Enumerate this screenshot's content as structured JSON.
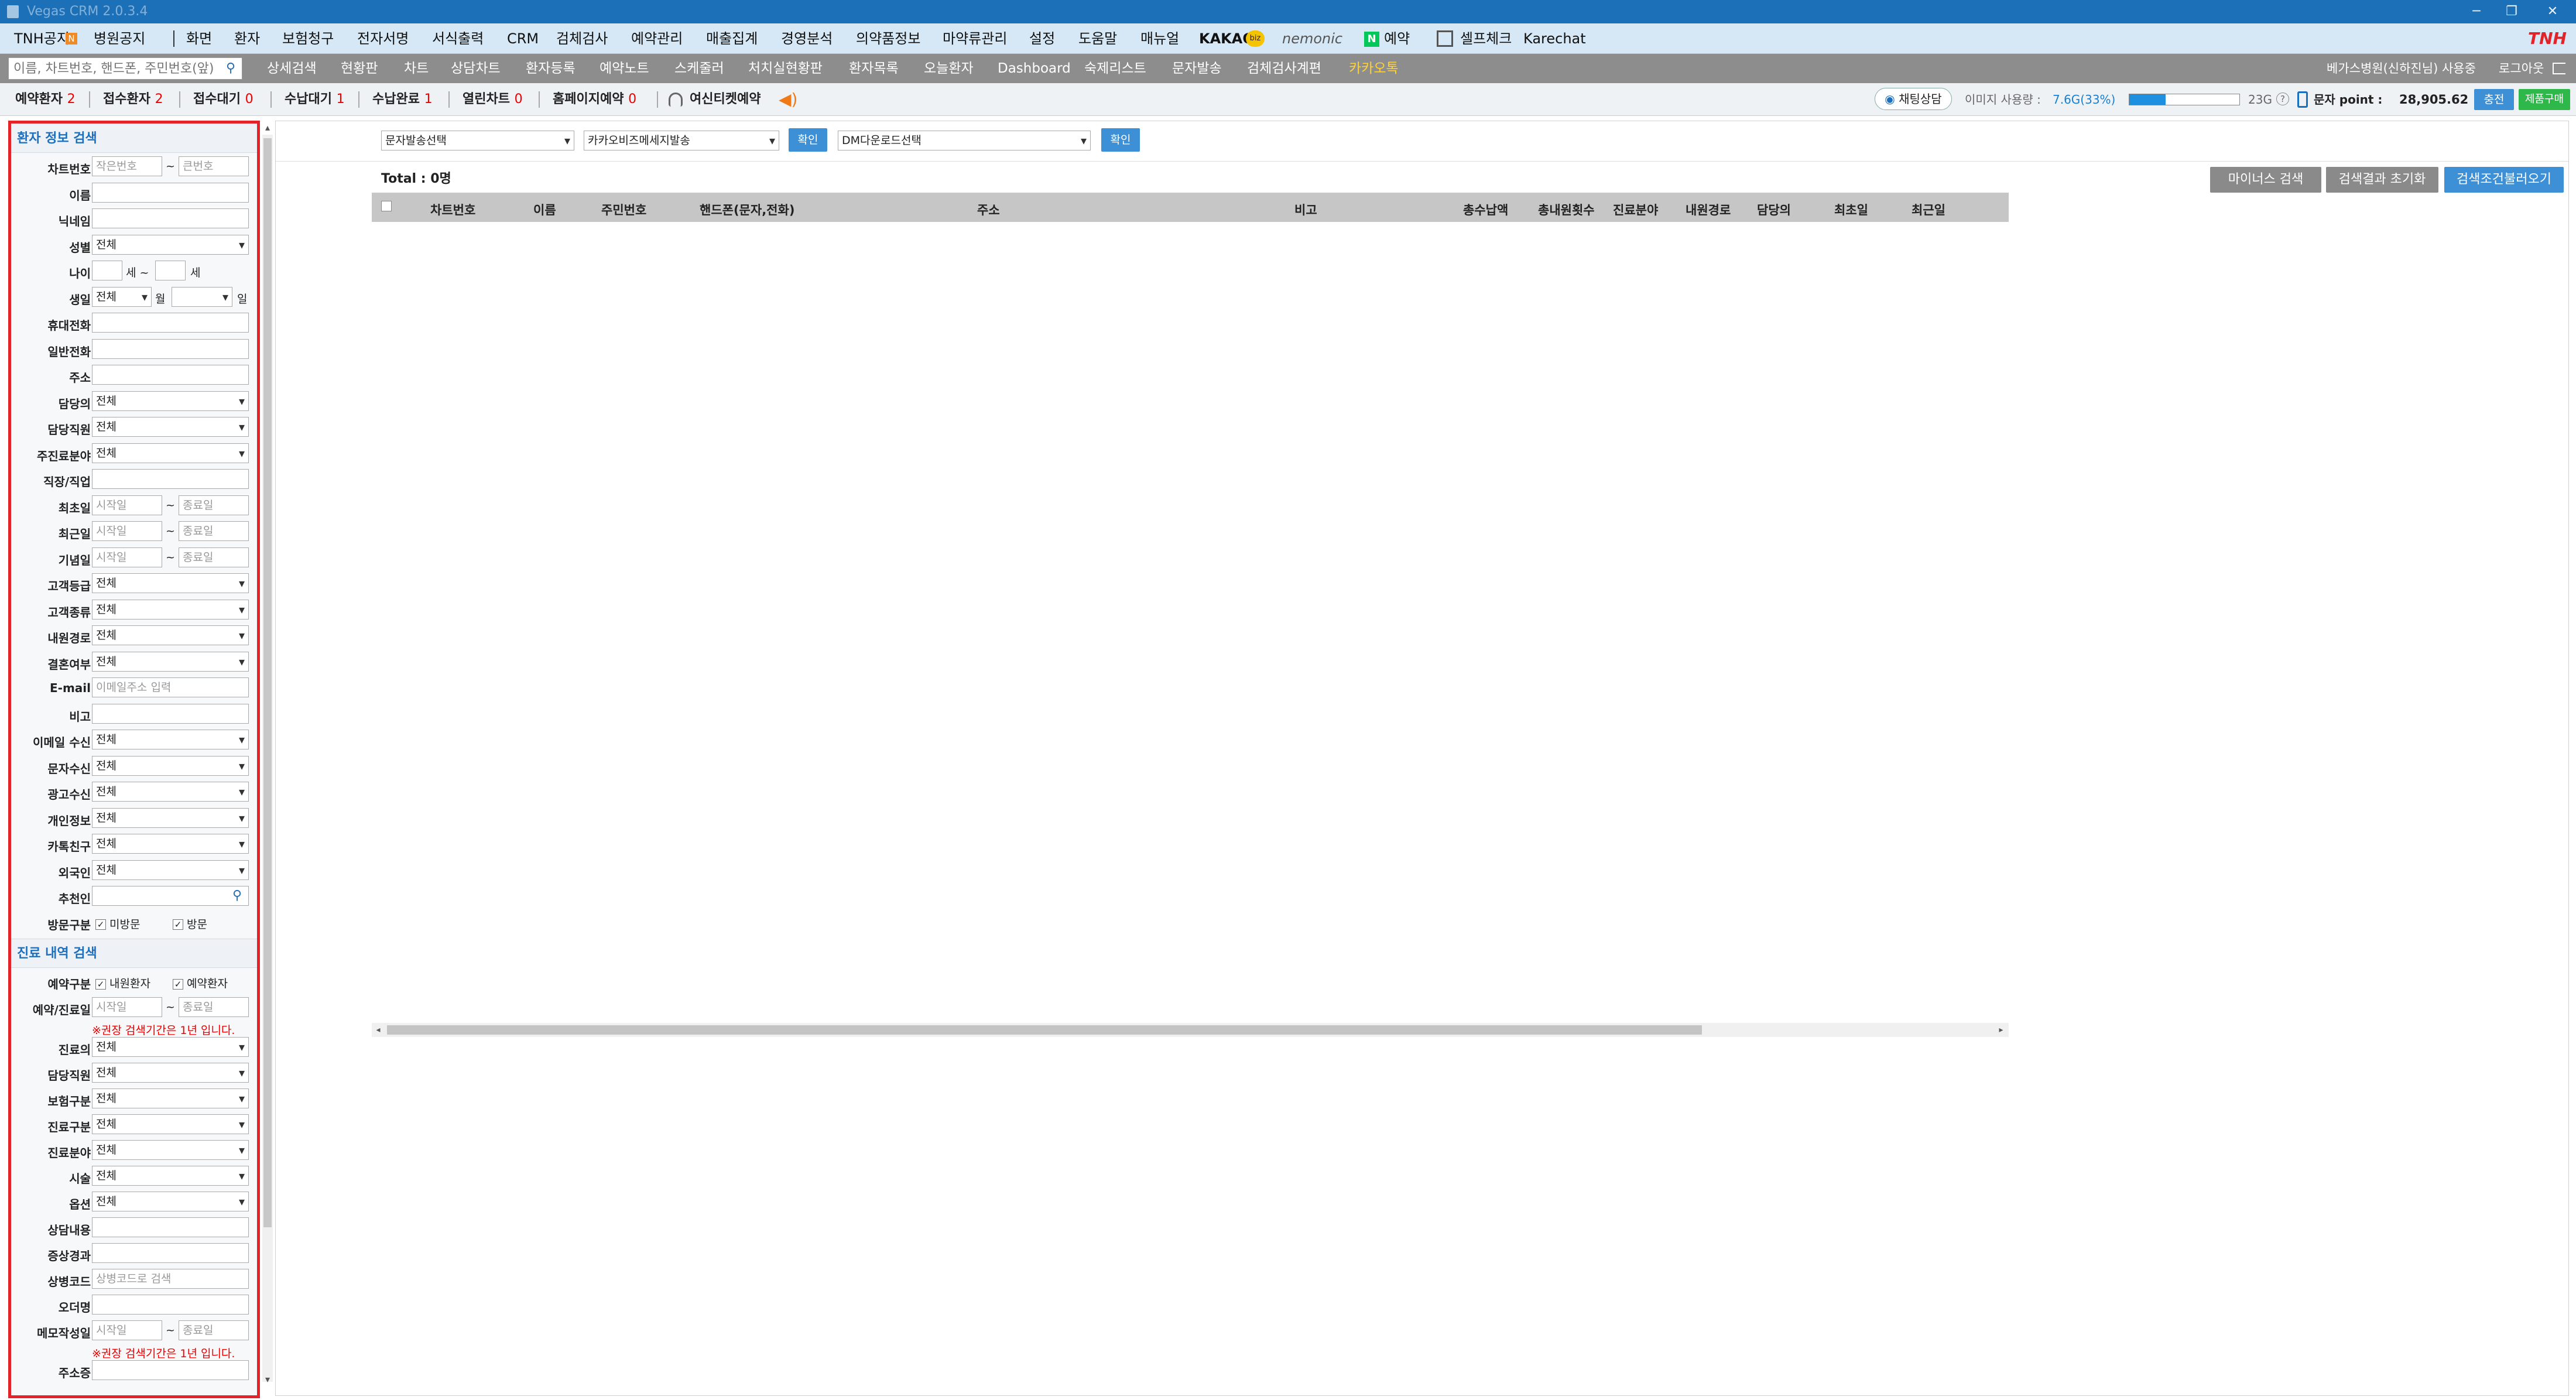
{
  "window": {
    "title": "Vegas CRM 2.0.3.4",
    "controls": [
      "─",
      "❐",
      "✕"
    ]
  },
  "menu": {
    "items": [
      "TNH공지",
      "병원공지",
      "화면",
      "환자",
      "보험청구",
      "전자서명",
      "서식출력",
      "CRM",
      "검체검사",
      "예약관리",
      "매출집계",
      "경영분석",
      "의약품정보",
      "마약류관리",
      "설정",
      "도움말",
      "매뉴얼",
      "KAKAO",
      "nemonic",
      "예약",
      "셀프체크",
      "Karechat"
    ],
    "brand": "TNH",
    "kakao_badge": "biz"
  },
  "toolbar": {
    "search_placeholder": "이름, 차트번호, 핸드폰, 주민번호(앞)",
    "items": [
      "상세검색",
      "현황판",
      "차트",
      "상담차트",
      "환자등록",
      "예약노트",
      "스케줄러",
      "처치실현황판",
      "환자목록",
      "오늘환자",
      "Dashboard",
      "숙제리스트",
      "문자발송",
      "검체검사계편",
      "카카오톡"
    ],
    "user": "베가스병원(신하진님) 사용중",
    "logout": "로그아웃"
  },
  "status": {
    "items": [
      {
        "label": "예약환자",
        "count": "2"
      },
      {
        "label": "접수환자",
        "count": "2"
      },
      {
        "label": "접수대기",
        "count": "0"
      },
      {
        "label": "수납대기",
        "count": "1"
      },
      {
        "label": "수납완료",
        "count": "1"
      },
      {
        "label": "열린차트",
        "count": "0"
      },
      {
        "label": "홈페이지예약",
        "count": "0"
      }
    ],
    "consult": "여신티켓예약",
    "chat": "채팅상담",
    "image_usage_label": "이미지 사용량 :",
    "image_usage_value": "7.6G(33%)",
    "image_usage_fraction": 0.33,
    "image_total": "23G",
    "sms_point_label": "문자 point :",
    "sms_point_value": "28,905.62",
    "charge": "충전",
    "buy": "제품구매"
  },
  "sidebar": {
    "section1_title": "환자 정보 검색",
    "section2_title": "진료 내역 검색",
    "fields1": [
      {
        "label": "차트번호",
        "type": "range",
        "ph1": "작은번호",
        "ph2": "큰번호"
      },
      {
        "label": "이름",
        "type": "text",
        "value": ""
      },
      {
        "label": "닉네임",
        "type": "text",
        "value": ""
      },
      {
        "label": "성별",
        "type": "select",
        "value": "전체"
      },
      {
        "label": "나이",
        "type": "age",
        "unit": "세",
        "tilde": "~"
      },
      {
        "label": "생일",
        "type": "birth",
        "value": "전체",
        "month": "월",
        "day": "일"
      },
      {
        "label": "휴대전화",
        "type": "text",
        "value": ""
      },
      {
        "label": "일반전화",
        "type": "text",
        "value": ""
      },
      {
        "label": "주소",
        "type": "text",
        "value": ""
      },
      {
        "label": "담당의",
        "type": "select",
        "value": "전체"
      },
      {
        "label": "담당직원",
        "type": "select",
        "value": "전체"
      },
      {
        "label": "주진료분야",
        "type": "select",
        "value": "전체"
      },
      {
        "label": "직장/직업",
        "type": "text",
        "value": ""
      },
      {
        "label": "최초일",
        "type": "range",
        "ph1": "시작일",
        "ph2": "종료일"
      },
      {
        "label": "최근일",
        "type": "range",
        "ph1": "시작일",
        "ph2": "종료일"
      },
      {
        "label": "기념일",
        "type": "range",
        "ph1": "시작일",
        "ph2": "종료일"
      },
      {
        "label": "고객등급",
        "type": "select",
        "value": "전체"
      },
      {
        "label": "고객종류",
        "type": "select",
        "value": "전체"
      },
      {
        "label": "내원경로",
        "type": "select",
        "value": "전체"
      },
      {
        "label": "결혼여부",
        "type": "select",
        "value": "전체"
      },
      {
        "label": "E-mail",
        "type": "text",
        "placeholder": "이메일주소 입력"
      },
      {
        "label": "비고",
        "type": "text",
        "value": ""
      },
      {
        "label": "이메일 수신",
        "type": "select",
        "value": "전체"
      },
      {
        "label": "문자수신",
        "type": "select",
        "value": "전체"
      },
      {
        "label": "광고수신",
        "type": "select",
        "value": "전체"
      },
      {
        "label": "개인정보",
        "type": "select",
        "value": "전체"
      },
      {
        "label": "카톡친구",
        "type": "select",
        "value": "전체"
      },
      {
        "label": "외국인",
        "type": "select",
        "value": "전체"
      },
      {
        "label": "추천인",
        "type": "search",
        "value": ""
      },
      {
        "label": "방문구분",
        "type": "checks",
        "options": [
          "미방문",
          "방문"
        ]
      }
    ],
    "fields2": [
      {
        "label": "예약구분",
        "type": "checks",
        "options": [
          "내원환자",
          "예약환자"
        ]
      },
      {
        "label": "예약/진료일",
        "type": "range",
        "ph1": "시작일",
        "ph2": "종료일",
        "warn": "※권장 검색기간은 1년 입니다."
      },
      {
        "label": "진료의",
        "type": "select",
        "value": "전체"
      },
      {
        "label": "담당직원",
        "type": "select",
        "value": "전체"
      },
      {
        "label": "보험구분",
        "type": "select",
        "value": "전체"
      },
      {
        "label": "진료구분",
        "type": "select",
        "value": "전체"
      },
      {
        "label": "진료분야",
        "type": "select",
        "value": "전체"
      },
      {
        "label": "시술",
        "type": "select",
        "value": "전체"
      },
      {
        "label": "옵션",
        "type": "select",
        "value": "전체"
      },
      {
        "label": "상담내용",
        "type": "text",
        "value": ""
      },
      {
        "label": "증상경과",
        "type": "text",
        "value": ""
      },
      {
        "label": "상병코드",
        "type": "text",
        "placeholder": "상병코드로 검색"
      },
      {
        "label": "오더명",
        "type": "text",
        "value": ""
      },
      {
        "label": "메모작성일",
        "type": "range",
        "ph1": "시작일",
        "ph2": "종료일",
        "warn": "※권장 검색기간은 1년 입니다."
      },
      {
        "label": "주소증",
        "type": "text",
        "value": ""
      }
    ]
  },
  "main": {
    "select1": "문자발송선택",
    "select2": "카카오비즈메세지발송",
    "select3": "DM다운로드선택",
    "confirm": "확인",
    "total": "Total : 0명",
    "buttons": [
      "마이너스 검색",
      "검색결과 초기화",
      "검색조건불러오기"
    ],
    "columns": [
      "차트번호",
      "이름",
      "주민번호",
      "핸드폰(문자,전화)",
      "주소",
      "비고",
      "총수납액",
      "총내원횟수",
      "진료분야",
      "내원경로",
      "담당의",
      "최초일",
      "최근일"
    ]
  },
  "colors": {
    "title": "#1c70b8",
    "menu": "#d6e8f6",
    "toolbar": "#8d8d8d",
    "highlight": "#e2232a",
    "blue_btn": "#3d8fd6",
    "green_btn": "#2fb84a"
  }
}
